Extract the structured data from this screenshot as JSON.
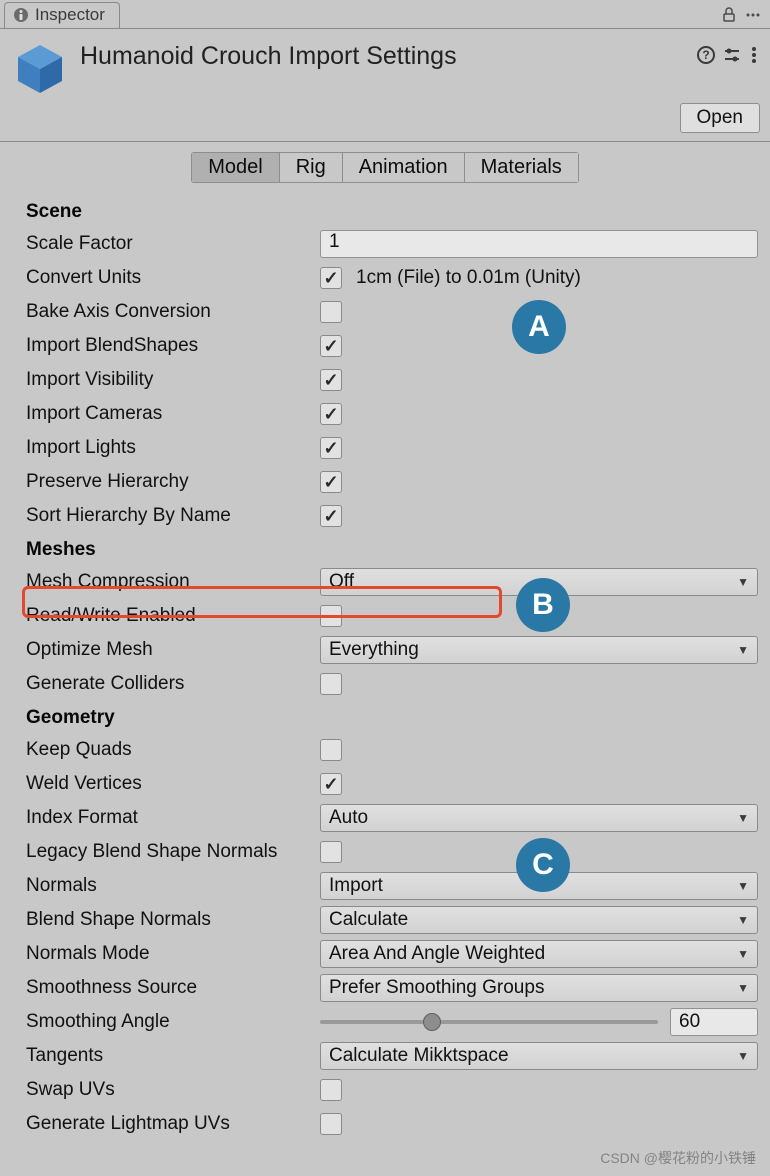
{
  "tab": {
    "label": "Inspector"
  },
  "header": {
    "title": "Humanoid Crouch Import Settings",
    "open_btn": "Open"
  },
  "tabs": {
    "model": "Model",
    "rig": "Rig",
    "animation": "Animation",
    "materials": "Materials"
  },
  "sections": {
    "scene": "Scene",
    "meshes": "Meshes",
    "geometry": "Geometry"
  },
  "scene": {
    "scale_factor": {
      "label": "Scale Factor",
      "value": "1"
    },
    "convert_units": {
      "label": "Convert Units",
      "hint": "1cm (File) to 0.01m (Unity)"
    },
    "bake_axis": {
      "label": "Bake Axis Conversion"
    },
    "import_blendshapes": {
      "label": "Import BlendShapes"
    },
    "import_visibility": {
      "label": "Import Visibility"
    },
    "import_cameras": {
      "label": "Import Cameras"
    },
    "import_lights": {
      "label": "Import Lights"
    },
    "preserve_hierarchy": {
      "label": "Preserve Hierarchy"
    },
    "sort_hierarchy": {
      "label": "Sort Hierarchy By Name"
    }
  },
  "meshes": {
    "mesh_compression": {
      "label": "Mesh Compression",
      "value": "Off"
    },
    "read_write": {
      "label": "Read/Write Enabled"
    },
    "optimize_mesh": {
      "label": "Optimize Mesh",
      "value": "Everything"
    },
    "generate_colliders": {
      "label": "Generate Colliders"
    }
  },
  "geometry": {
    "keep_quads": {
      "label": "Keep Quads"
    },
    "weld_vertices": {
      "label": "Weld Vertices"
    },
    "index_format": {
      "label": "Index Format",
      "value": "Auto"
    },
    "legacy_bsn": {
      "label": "Legacy Blend Shape Normals"
    },
    "normals": {
      "label": "Normals",
      "value": "Import"
    },
    "blend_shape_normals": {
      "label": "Blend Shape Normals",
      "value": "Calculate"
    },
    "normals_mode": {
      "label": "Normals Mode",
      "value": "Area And Angle Weighted"
    },
    "smoothness_source": {
      "label": "Smoothness Source",
      "value": "Prefer Smoothing Groups"
    },
    "smoothing_angle": {
      "label": "Smoothing Angle",
      "value": "60"
    },
    "tangents": {
      "label": "Tangents",
      "value": "Calculate Mikktspace"
    },
    "swap_uvs": {
      "label": "Swap UVs"
    },
    "generate_lightmap_uvs": {
      "label": "Generate Lightmap UVs"
    }
  },
  "badges": {
    "a": "A",
    "b": "B",
    "c": "C"
  },
  "watermark": "CSDN @樱花粉的小铁锤"
}
